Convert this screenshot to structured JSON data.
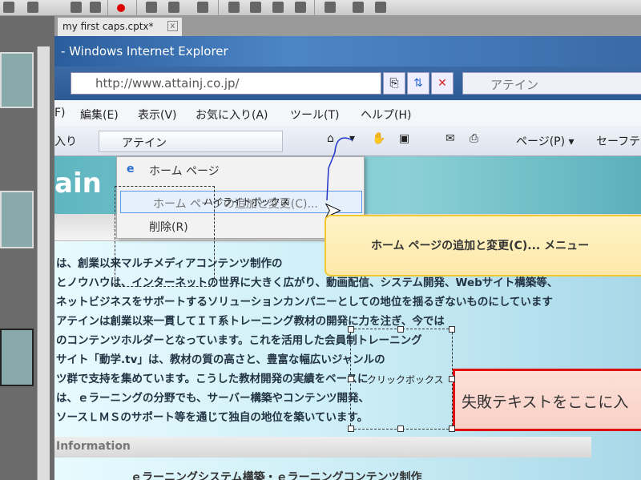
{
  "app": {
    "tab_label": "my first caps.cptx*",
    "tab_close": "x"
  },
  "browser": {
    "title": "- Windows Internet Explorer",
    "address": "http://www.attainj.co.jp/",
    "search": "アテイン",
    "menu": [
      "F)",
      "編集(E)",
      "表示(V)",
      "お気に入り(A)",
      "ツール(T)",
      "ヘルプ(H)"
    ],
    "favorites_label": "入り",
    "favorite_tab": "アテイン",
    "page_menu": "ページ(P) ▾",
    "safety_menu": "セーフテ"
  },
  "page": {
    "logo_fragment": "ain",
    "lines": [
      "は、創業以来マルチメディアコンテンツ制作の",
      "とノウハウは、インターネットの世界に大きく広がり、動画配信、システム開発、Webサイト構築等、",
      "ネットビジネスをサポートするソリューションカンパニーとしての地位を揺るぎないものにしています",
      "アテインは創業以来一貫してＩＴ系トレーニング教材の開発に力を注ぎ、今では",
      "のコンテンツホルダーとなっています。これを活用した会員制トレーニング",
      "サイト「動学.tv」は、教材の質の高さと、豊富な幅広いジャンルの",
      "ツ群で支持を集めています。こうした教材開発の実績をベースに",
      "は、ｅラーニングの分野でも、サーバー構築やコンテンツ開発、",
      "ソースＬＭＳのサポート等を通じて独自の地位を築いています。"
    ],
    "info_header": "Information",
    "info_item": "ｅラーニングシステム構築・ｅラーニングコンテンツ制作"
  },
  "dropdown": {
    "items": [
      "ホーム ページ",
      "ホーム ページの追加と変更(C)...",
      "削除(R)"
    ],
    "highlight_label": "ハイライトボックス"
  },
  "captions": {
    "success": "ホーム ページの追加と変更(C)... メニュー",
    "failure": "失敗テキストをここに入",
    "click_box": "クリックボックス"
  }
}
